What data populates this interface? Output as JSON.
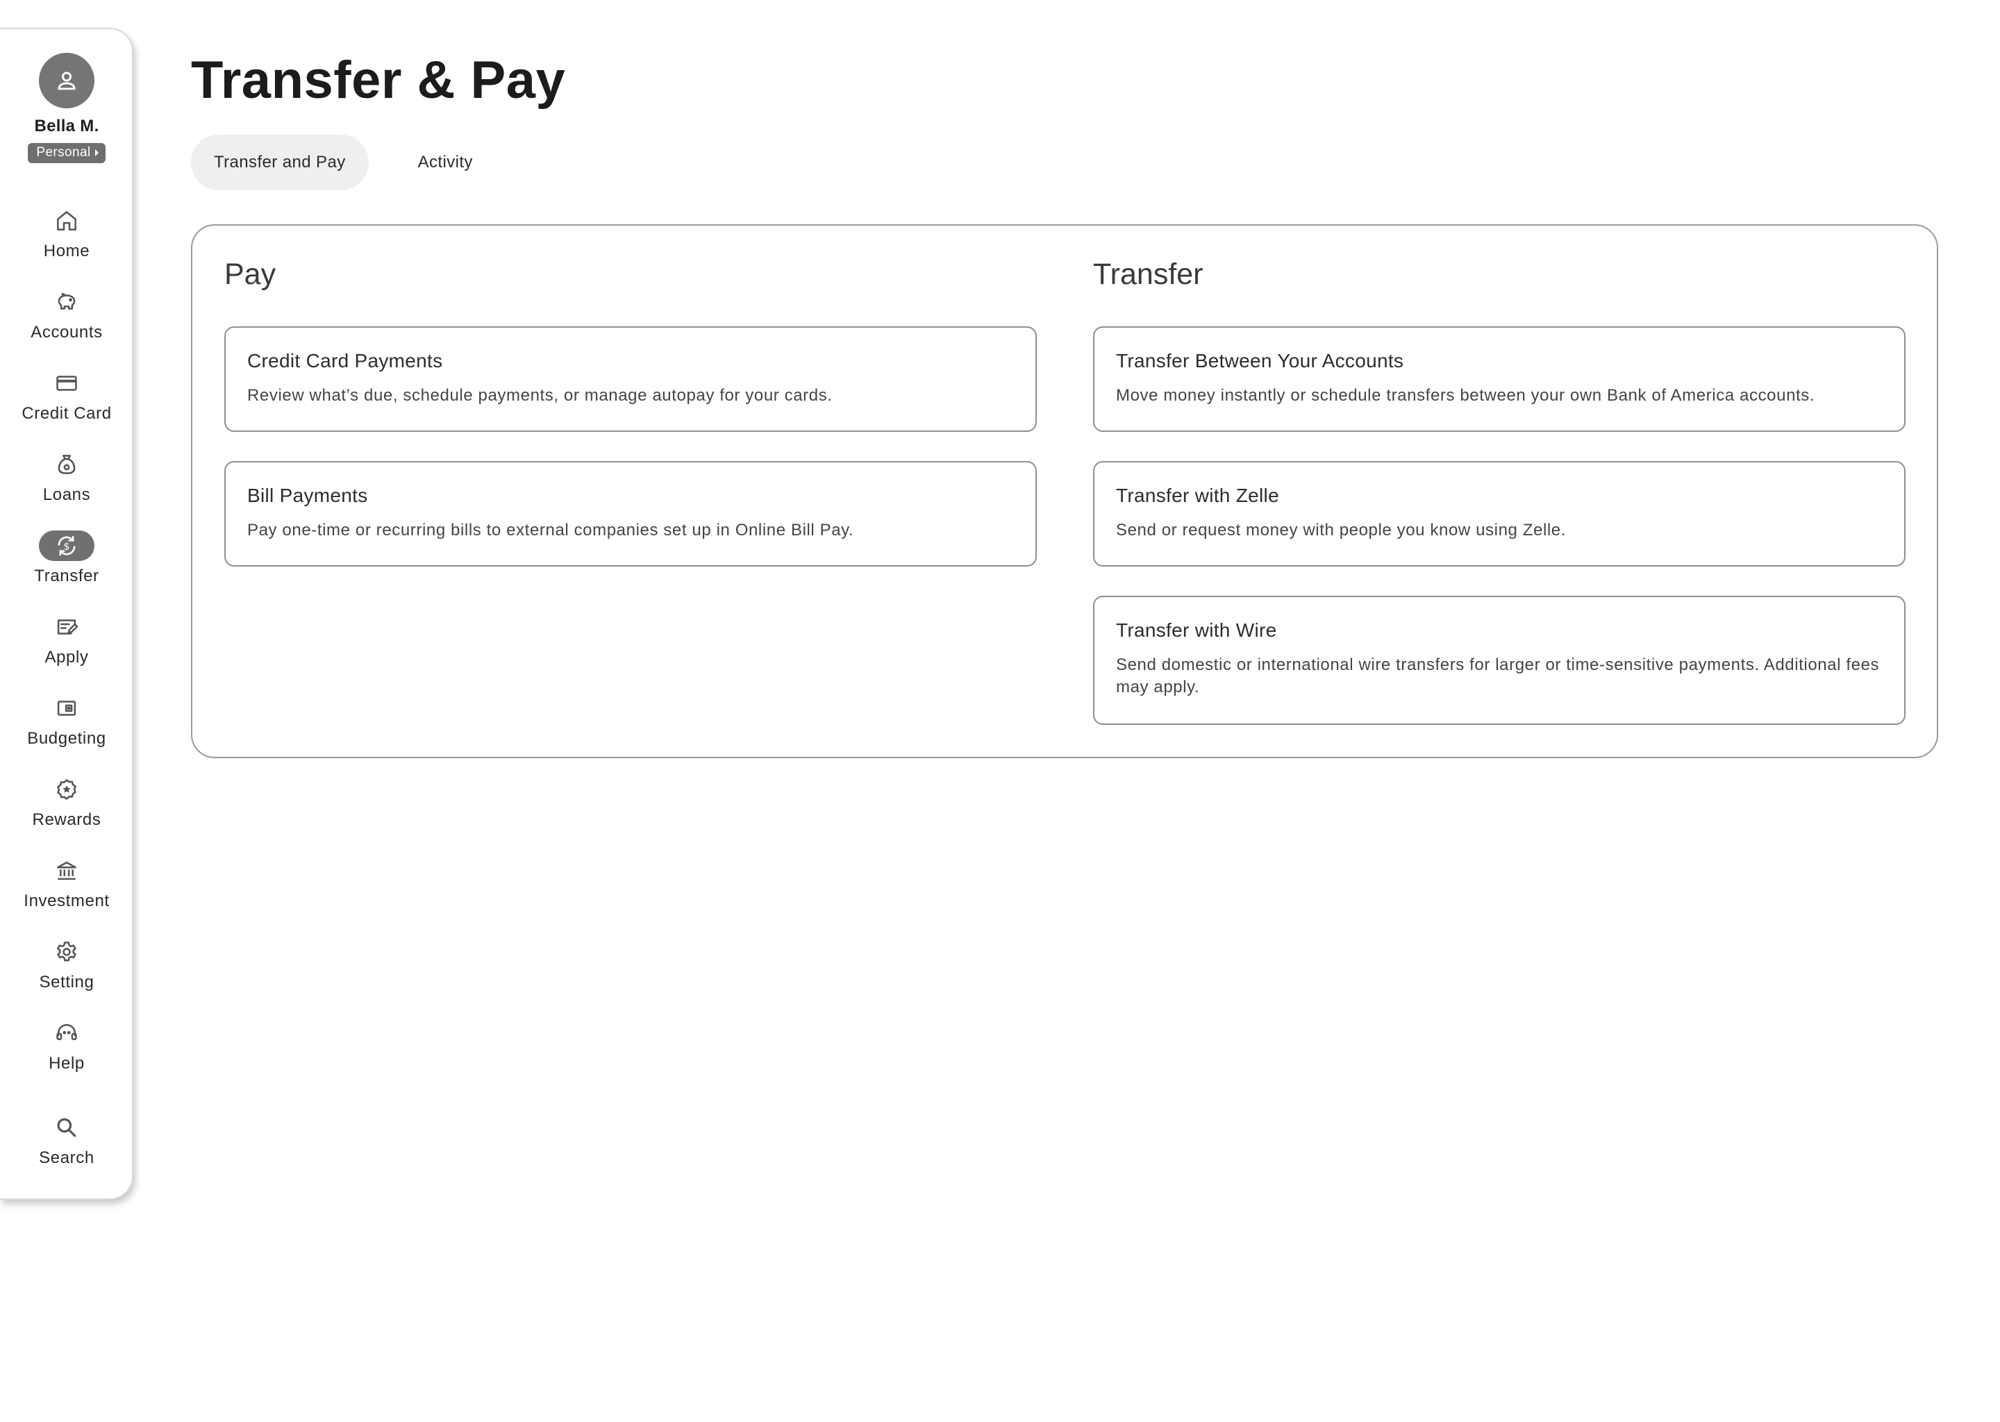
{
  "profile": {
    "name": "Bella M.",
    "account_type": "Personal"
  },
  "sidebar": {
    "items": [
      {
        "label": "Home",
        "icon": "home-icon",
        "active": false
      },
      {
        "label": "Accounts",
        "icon": "piggy-bank-icon",
        "active": false
      },
      {
        "label": "Credit Card",
        "icon": "credit-card-icon",
        "active": false
      },
      {
        "label": "Loans",
        "icon": "money-bag-icon",
        "active": false
      },
      {
        "label": "Transfer",
        "icon": "transfer-icon",
        "active": true
      },
      {
        "label": "Apply",
        "icon": "apply-form-icon",
        "active": false
      },
      {
        "label": "Budgeting",
        "icon": "wallet-icon",
        "active": false
      },
      {
        "label": "Rewards",
        "icon": "rewards-star-icon",
        "active": false
      },
      {
        "label": "Investment",
        "icon": "bank-building-icon",
        "active": false
      },
      {
        "label": "Setting",
        "icon": "gear-icon",
        "active": false
      },
      {
        "label": "Help",
        "icon": "headset-icon",
        "active": false
      },
      {
        "label": "Search",
        "icon": "search-icon",
        "active": false
      }
    ]
  },
  "main": {
    "title": "Transfer & Pay",
    "tabs": [
      {
        "label": "Transfer and Pay",
        "active": true
      },
      {
        "label": "Activity",
        "active": false
      }
    ],
    "pay": {
      "title": "Pay",
      "cards": [
        {
          "title": "Credit Card Payments",
          "description": "Review what’s due, schedule payments, or manage autopay for your cards."
        },
        {
          "title": "Bill Payments",
          "description": "Pay one-time or recurring bills to external companies set up in Online Bill Pay."
        }
      ]
    },
    "transfer": {
      "title": "Transfer",
      "cards": [
        {
          "title": "Transfer Between Your Accounts",
          "description": "Move money instantly or schedule transfers between your own Bank of America accounts."
        },
        {
          "title": "Transfer with Zelle",
          "description": "Send or request money with people you know using Zelle."
        },
        {
          "title": "Transfer with Wire",
          "description": "Send domestic or international wire transfers for larger or time-sensitive payments. Additional fees may apply."
        }
      ]
    }
  },
  "colors": {
    "active_nav": "#707070",
    "avatar": "#757575",
    "active_tab": "#efefef",
    "border": "#9a9a9a"
  }
}
